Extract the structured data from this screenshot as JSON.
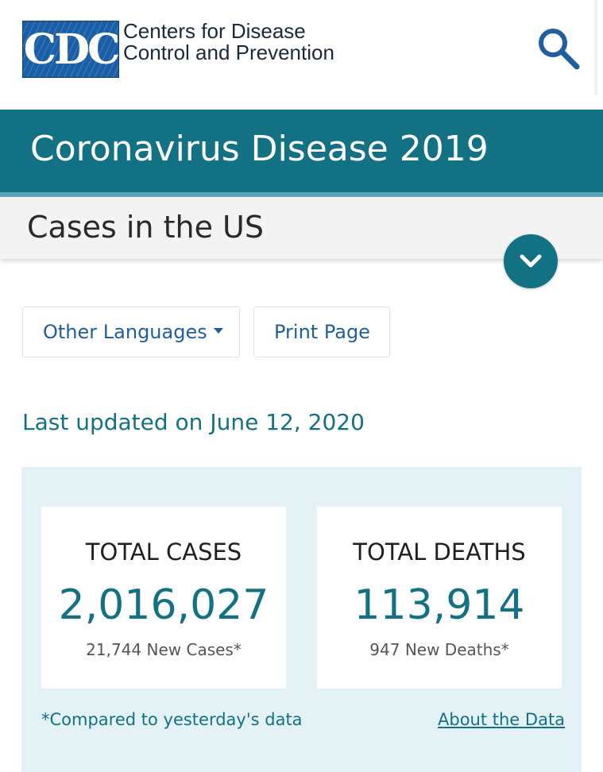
{
  "header": {
    "logo_text": "CDC",
    "agency_line1": "Centers for Disease",
    "agency_line2": "Control and Prevention",
    "search_icon": "search-icon"
  },
  "topic": {
    "title": "Coronavirus Disease 2019"
  },
  "subnav": {
    "title": "Cases in the US",
    "toggle_icon": "chevron-down-icon"
  },
  "actions": {
    "languages_label": "Other Languages",
    "print_label": "Print Page"
  },
  "updated": "Last updated on June 12, 2020",
  "stats": {
    "cases": {
      "label": "TOTAL CASES",
      "value": "2,016,027",
      "new": "21,744 New Cases*"
    },
    "deaths": {
      "label": "TOTAL DEATHS",
      "value": "113,914",
      "new": "947 New Deaths*"
    },
    "footnote": "*Compared to yesterday's data",
    "about_link": "About the Data"
  },
  "colors": {
    "teal": "#137184",
    "teal_light": "#5ba6b6",
    "panel_bg": "#e4f2f5",
    "link_blue": "#1f5fa0",
    "logo_blue": "#1a5fa6"
  }
}
